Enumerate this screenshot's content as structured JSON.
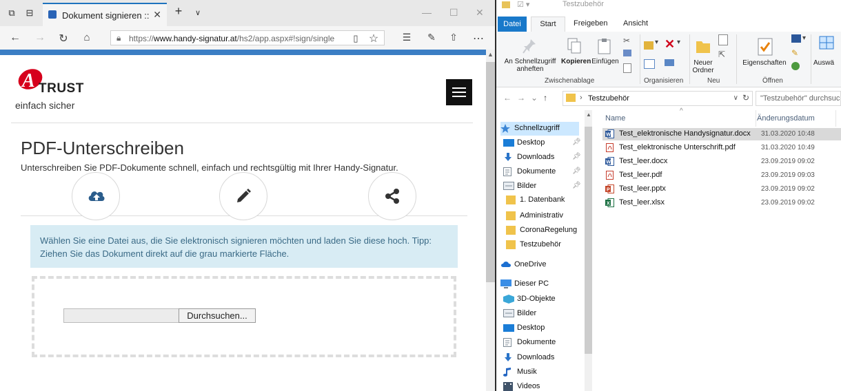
{
  "browser": {
    "tab_title": "Dokument signieren :: H",
    "url_prefix": "https://",
    "url_host": "www.handy-signatur.at",
    "url_path": "/hs2/app.aspx#!sign/single"
  },
  "site": {
    "logo_letter": "A",
    "logo_word": "TRUST",
    "logo_tagline": "einfach sicher",
    "page_title": "PDF-Unterschreiben",
    "lead": "Unterschreiben Sie PDF-Dokumente schnell, einfach und rechtsgültig mit Ihrer Handy-Signatur.",
    "info": "Wählen Sie eine Datei aus, die Sie elektronisch signieren möchten und laden Sie diese hoch. Tipp: Ziehen Sie das Dokument direkt auf die grau markierte Fläche.",
    "browse_label": "Durchsuchen..."
  },
  "explorer": {
    "window_title": "Testzubehör",
    "tabs": [
      "Datei",
      "Start",
      "Freigeben",
      "Ansicht"
    ],
    "ribbon": {
      "pin": [
        "An Schnellzugriff",
        "anheften"
      ],
      "copy": "Kopieren",
      "paste": "Einfügen",
      "new_folder": [
        "Neuer",
        "Ordner"
      ],
      "properties": "Eigenschaften",
      "select": "Auswä",
      "groups": [
        "Zwischenablage",
        "Organisieren",
        "Neu",
        "Öffnen"
      ]
    },
    "breadcrumb": "Testzubehör",
    "search_placeholder": "\"Testzubehör\" durchsuchen",
    "columns": {
      "name": "Name",
      "date": "Änderungsdatum"
    },
    "nav": [
      {
        "label": "Schnellzugriff",
        "icon": "star-icon"
      },
      {
        "label": "Desktop",
        "icon": "desktop-icon"
      },
      {
        "label": "Downloads",
        "icon": "download-icon"
      },
      {
        "label": "Dokumente",
        "icon": "documents-icon"
      },
      {
        "label": "Bilder",
        "icon": "pictures-icon"
      },
      {
        "label": "1. Datenbank",
        "icon": "folder-icon"
      },
      {
        "label": "Administrativ",
        "icon": "folder-icon"
      },
      {
        "label": "CoronaRegelung",
        "icon": "folder-icon"
      },
      {
        "label": "Testzubehör",
        "icon": "folder-icon"
      },
      {
        "label": "OneDrive",
        "icon": "cloud-icon"
      },
      {
        "label": "Dieser PC",
        "icon": "computer-icon"
      },
      {
        "label": "3D-Objekte",
        "icon": "cube-icon"
      },
      {
        "label": "Bilder",
        "icon": "pictures-icon"
      },
      {
        "label": "Desktop",
        "icon": "desktop-icon"
      },
      {
        "label": "Dokumente",
        "icon": "documents-icon"
      },
      {
        "label": "Downloads",
        "icon": "download-icon"
      },
      {
        "label": "Musik",
        "icon": "music-icon"
      },
      {
        "label": "Videos",
        "icon": "video-icon"
      }
    ],
    "files": [
      {
        "name": "Test_elektronische Handysignatur.docx",
        "date": "31.03.2020 10:48",
        "type": "word"
      },
      {
        "name": "Test_elektronische Unterschrift.pdf",
        "date": "31.03.2020 10:49",
        "type": "pdf"
      },
      {
        "name": "Test_leer.docx",
        "date": "23.09.2019 09:02",
        "type": "word"
      },
      {
        "name": "Test_leer.pdf",
        "date": "23.09.2019 09:03",
        "type": "pdf"
      },
      {
        "name": "Test_leer.pptx",
        "date": "23.09.2019 09:02",
        "type": "powerpoint"
      },
      {
        "name": "Test_leer.xlsx",
        "date": "23.09.2019 09:02",
        "type": "excel"
      }
    ]
  }
}
